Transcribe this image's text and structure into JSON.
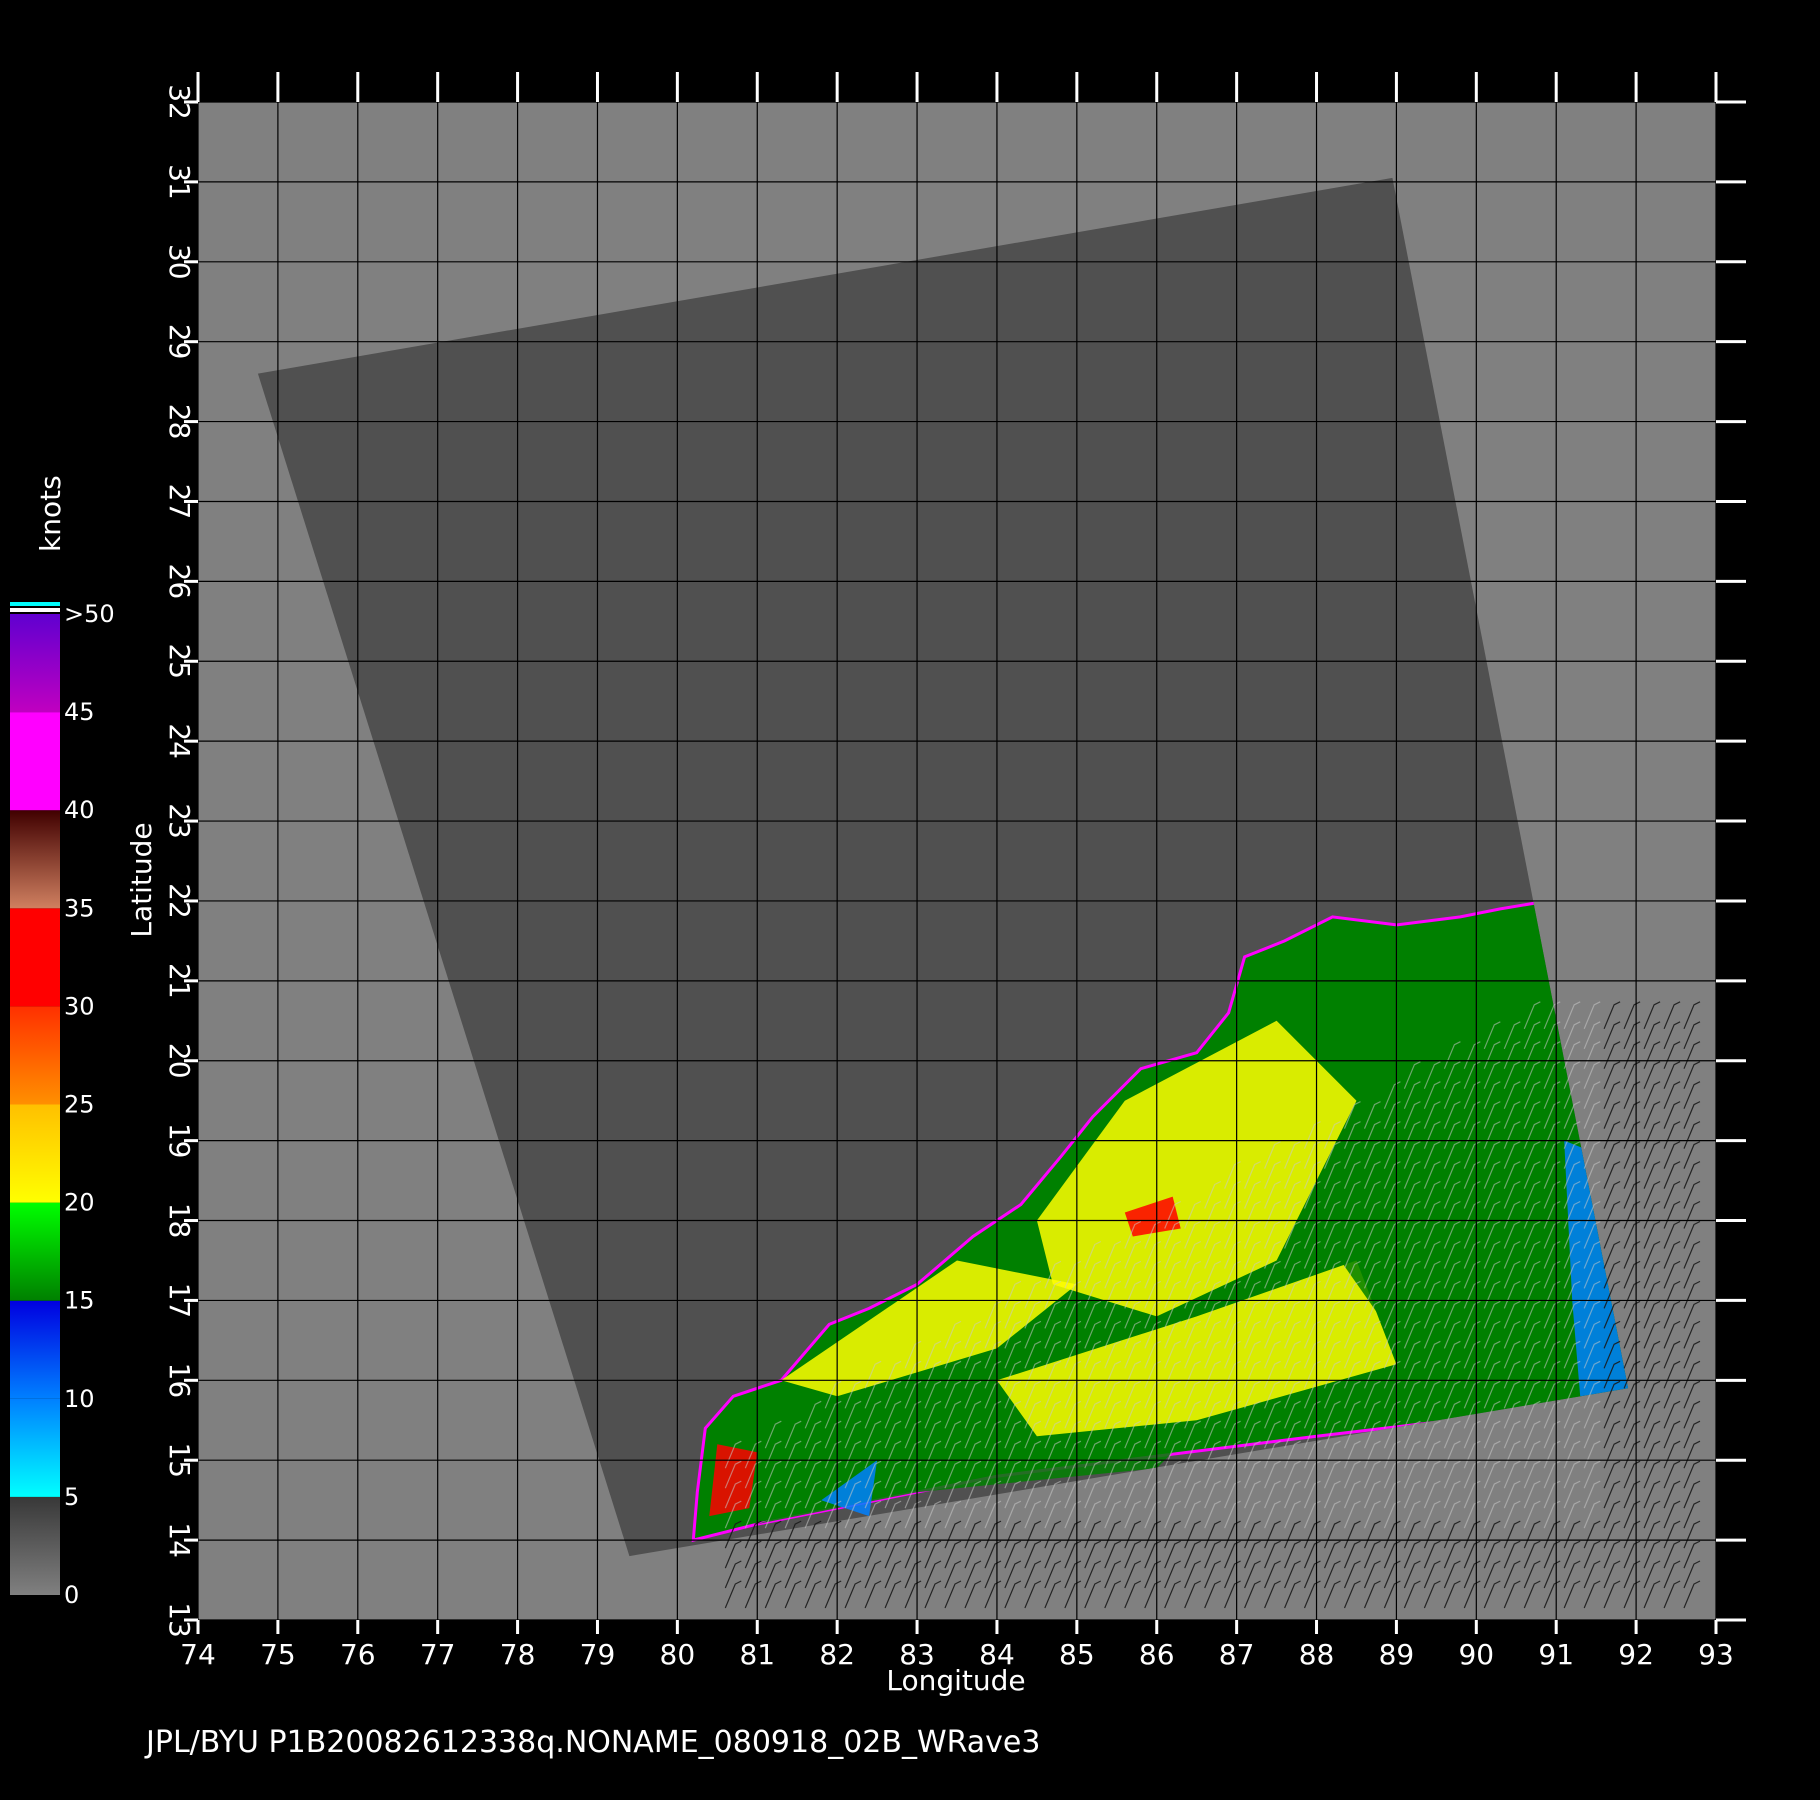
{
  "map": {
    "footer_text": "JPL/BYU  P1B20082612338q.NONAME_080918_02B_WRave3",
    "x_axis_title": "Longitude",
    "y_axis_title": "Latitude",
    "lon_range": [
      74,
      93
    ],
    "lat_range": [
      13,
      32
    ],
    "lon_ticks": [
      74,
      75,
      76,
      77,
      78,
      79,
      80,
      81,
      82,
      83,
      84,
      85,
      86,
      87,
      88,
      89,
      90,
      91,
      92,
      93
    ],
    "lat_ticks": [
      13,
      14,
      15,
      16,
      17,
      18,
      19,
      20,
      21,
      22,
      23,
      24,
      25,
      26,
      27,
      28,
      29,
      30,
      31,
      32
    ],
    "grid": true,
    "colors": {
      "background": "#000000",
      "land": "#808080",
      "swath": "#505050",
      "grid": "#000000",
      "ticks": "#ffffff"
    },
    "swath_corners": [
      [
        74.75,
        28.6
      ],
      [
        88.95,
        31.05
      ],
      [
        91.9,
        15.9
      ],
      [
        79.4,
        13.8
      ]
    ]
  },
  "legend": {
    "units": "knots",
    "labels": [
      "0",
      "5",
      "10",
      "15",
      "20",
      "25",
      "30",
      "35",
      "40",
      "45",
      ">50"
    ],
    "bands": [
      {
        "from": 0,
        "to": 5,
        "colors": [
          "#808080",
          "#383838"
        ]
      },
      {
        "from": 5,
        "to": 10,
        "colors": [
          "#00ffff",
          "#0080ff"
        ]
      },
      {
        "from": 10,
        "to": 15,
        "colors": [
          "#0080ff",
          "#0000e0"
        ]
      },
      {
        "from": 15,
        "to": 20,
        "colors": [
          "#008000",
          "#00ff00"
        ]
      },
      {
        "from": 20,
        "to": 25,
        "colors": [
          "#ffff00",
          "#ffc000"
        ]
      },
      {
        "from": 25,
        "to": 30,
        "colors": [
          "#ff9000",
          "#ff3000"
        ]
      },
      {
        "from": 30,
        "to": 35,
        "colors": [
          "#ff0000",
          "#ff0000"
        ]
      },
      {
        "from": 35,
        "to": 40,
        "colors": [
          "#d08060",
          "#400000"
        ]
      },
      {
        "from": 40,
        "to": 45,
        "colors": [
          "#ff00ff",
          "#ff00ff"
        ]
      },
      {
        "from": 45,
        "to": 50,
        "colors": [
          "#c000c0",
          "#6000d0"
        ]
      }
    ]
  },
  "wind_field": {
    "outline": [
      [
        80.2,
        14.0
      ],
      [
        80.25,
        14.6
      ],
      [
        80.35,
        15.4
      ],
      [
        80.7,
        15.8
      ],
      [
        81.3,
        16.0
      ],
      [
        81.9,
        16.7
      ],
      [
        82.4,
        16.9
      ],
      [
        83.0,
        17.2
      ],
      [
        83.7,
        17.8
      ],
      [
        84.3,
        18.2
      ],
      [
        84.8,
        18.8
      ],
      [
        85.2,
        19.3
      ],
      [
        85.8,
        19.9
      ],
      [
        86.5,
        20.1
      ],
      [
        86.9,
        20.6
      ],
      [
        87.1,
        21.3
      ],
      [
        87.6,
        21.5
      ],
      [
        88.2,
        21.8
      ],
      [
        89.0,
        21.7
      ],
      [
        89.8,
        21.8
      ],
      [
        90.3,
        21.9
      ],
      [
        90.9,
        22.0
      ],
      [
        91.15,
        21.6
      ],
      [
        92.25,
        15.8
      ],
      [
        88.0,
        15.3
      ],
      [
        84.0,
        14.8
      ],
      [
        81.0,
        14.2
      ]
    ],
    "regions": [
      {
        "speed": 22,
        "polygon": [
          [
            84.5,
            18.0
          ],
          [
            85.6,
            19.5
          ],
          [
            87.5,
            20.5
          ],
          [
            88.5,
            19.5
          ],
          [
            87.5,
            17.5
          ],
          [
            86.0,
            16.8
          ],
          [
            84.7,
            17.2
          ]
        ]
      },
      {
        "speed": 22,
        "polygon": [
          [
            81.3,
            16.0
          ],
          [
            83.5,
            17.5
          ],
          [
            85.0,
            17.2
          ],
          [
            84.0,
            16.4
          ],
          [
            82.0,
            15.8
          ]
        ]
      },
      {
        "speed": 22,
        "polygon": [
          [
            84.0,
            16.0
          ],
          [
            86.5,
            16.8
          ],
          [
            88.5,
            17.5
          ],
          [
            89.0,
            16.2
          ],
          [
            86.5,
            15.5
          ],
          [
            84.5,
            15.3
          ]
        ]
      },
      {
        "speed": 17,
        "polygon": [
          [
            88.5,
            19.5
          ],
          [
            89.5,
            20.5
          ],
          [
            90.5,
            21.0
          ],
          [
            91.0,
            19.5
          ],
          [
            90.5,
            17.0
          ],
          [
            89.0,
            16.5
          ],
          [
            88.3,
            17.5
          ]
        ]
      },
      {
        "speed": 17,
        "polygon": [
          [
            81.0,
            14.2
          ],
          [
            83.0,
            14.9
          ],
          [
            85.0,
            15.2
          ],
          [
            86.5,
            15.4
          ],
          [
            86.0,
            14.9
          ],
          [
            83.0,
            14.6
          ]
        ]
      },
      {
        "speed": 12,
        "polygon": [
          [
            91.1,
            19.0
          ],
          [
            91.6,
            18.8
          ],
          [
            92.2,
            15.9
          ],
          [
            91.3,
            15.8
          ],
          [
            91.2,
            17.0
          ]
        ]
      },
      {
        "speed": 12,
        "polygon": [
          [
            81.8,
            14.5
          ],
          [
            82.5,
            15.0
          ],
          [
            82.4,
            14.3
          ]
        ]
      },
      {
        "speed": 30,
        "polygon": [
          [
            80.4,
            14.3
          ],
          [
            80.5,
            15.2
          ],
          [
            81.0,
            15.1
          ],
          [
            80.9,
            14.4
          ]
        ]
      },
      {
        "speed": 30,
        "polygon": [
          [
            85.6,
            18.1
          ],
          [
            86.2,
            18.3
          ],
          [
            86.3,
            17.9
          ],
          [
            85.7,
            17.8
          ]
        ]
      }
    ]
  }
}
